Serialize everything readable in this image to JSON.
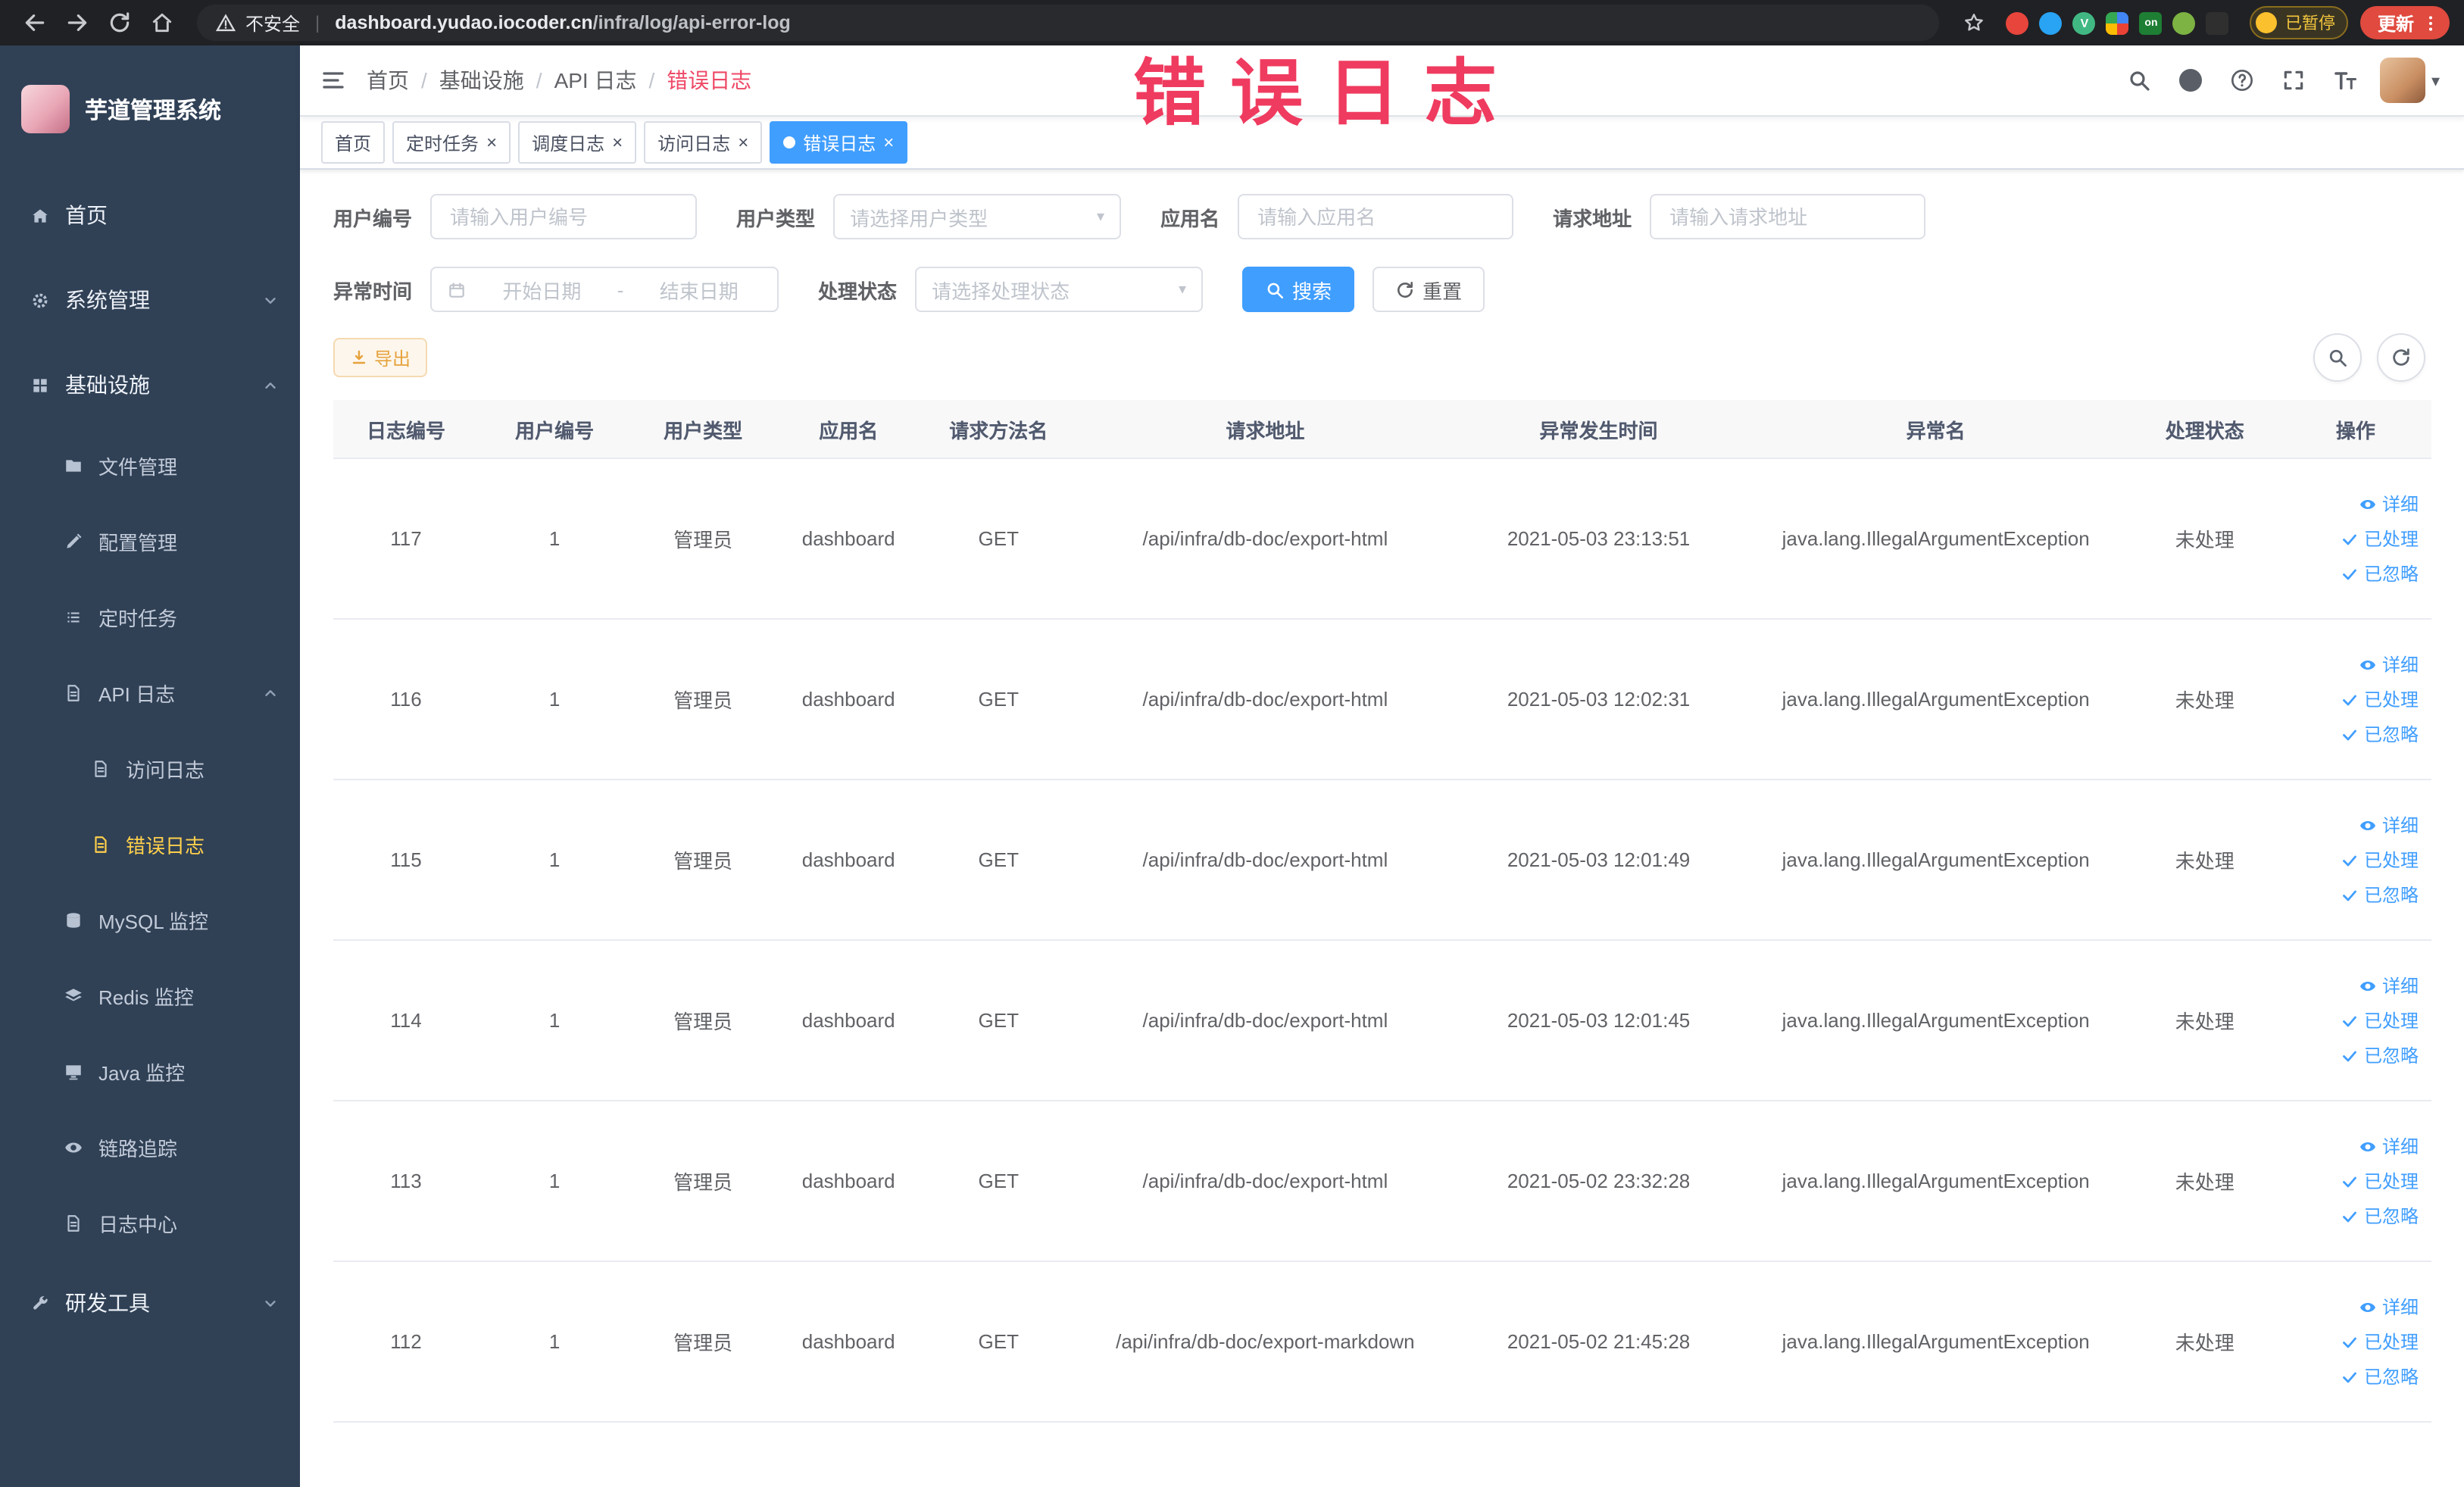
{
  "browser": {
    "security_label": "不安全",
    "url_domain": "dashboard.yudao.iocoder.cn",
    "url_path": "/infra/log/api-error-log",
    "profile_badge": "已暂停",
    "update_label": "更新",
    "extension_on_label": "on",
    "extension_vue_label": "V"
  },
  "annotation": {
    "text": "错误日志"
  },
  "sidebar": {
    "title": "芋道管理系统",
    "items": [
      {
        "key": "home",
        "label": "首页",
        "icon": "home-icon",
        "level": 1
      },
      {
        "key": "system",
        "label": "系统管理",
        "icon": "gear-icon",
        "level": 1,
        "chevron": "down"
      },
      {
        "key": "infra",
        "label": "基础设施",
        "icon": "infra-icon",
        "level": 1,
        "chevron": "up"
      },
      {
        "key": "file",
        "label": "文件管理",
        "icon": "folder-icon",
        "level": 2
      },
      {
        "key": "config",
        "label": "配置管理",
        "icon": "edit-icon",
        "level": 2
      },
      {
        "key": "job",
        "label": "定时任务",
        "icon": "list-icon",
        "level": 2
      },
      {
        "key": "api-log",
        "label": "API 日志",
        "icon": "doc-icon",
        "level": 2,
        "chevron": "up"
      },
      {
        "key": "access-log",
        "label": "访问日志",
        "icon": "doc-icon",
        "level": 3
      },
      {
        "key": "error-log",
        "label": "错误日志",
        "icon": "doc-icon",
        "level": 3,
        "active": true
      },
      {
        "key": "mysql",
        "label": "MySQL 监控",
        "icon": "database-icon",
        "level": 2
      },
      {
        "key": "redis",
        "label": "Redis 监控",
        "icon": "layers-icon",
        "level": 2
      },
      {
        "key": "java",
        "label": "Java 监控",
        "icon": "monitor-icon",
        "level": 2
      },
      {
        "key": "trace",
        "label": "链路追踪",
        "icon": "eye-icon",
        "level": 2
      },
      {
        "key": "log-center",
        "label": "日志中心",
        "icon": "doc-icon",
        "level": 2
      },
      {
        "key": "dev-tools",
        "label": "研发工具",
        "icon": "tool-icon",
        "level": 1,
        "chevron": "down"
      }
    ]
  },
  "navbar": {
    "breadcrumb": [
      "首页",
      "基础设施",
      "API 日志",
      "错误日志"
    ]
  },
  "tabs": [
    {
      "label": "首页",
      "closable": false,
      "active": false
    },
    {
      "label": "定时任务",
      "closable": true,
      "active": false
    },
    {
      "label": "调度日志",
      "closable": true,
      "active": false
    },
    {
      "label": "访问日志",
      "closable": true,
      "active": false
    },
    {
      "label": "错误日志",
      "closable": true,
      "active": true
    }
  ],
  "filters": {
    "user_id": {
      "label": "用户编号",
      "placeholder": "请输入用户编号"
    },
    "user_type": {
      "label": "用户类型",
      "placeholder": "请选择用户类型"
    },
    "app_name": {
      "label": "应用名",
      "placeholder": "请输入应用名"
    },
    "request_url": {
      "label": "请求地址",
      "placeholder": "请输入请求地址"
    },
    "exception_time": {
      "label": "异常时间",
      "start_placeholder": "开始日期",
      "separator": "-",
      "end_placeholder": "结束日期"
    },
    "process_status": {
      "label": "处理状态",
      "placeholder": "请选择处理状态"
    },
    "search_label": "搜索",
    "reset_label": "重置"
  },
  "toolbar": {
    "export_label": "导出"
  },
  "table": {
    "headers": [
      "日志编号",
      "用户编号",
      "用户类型",
      "应用名",
      "请求方法名",
      "请求地址",
      "异常发生时间",
      "异常名",
      "处理状态",
      "操作"
    ],
    "actions": [
      "详细",
      "已处理",
      "已忽略"
    ],
    "rows": [
      {
        "id": "117",
        "user_id": "1",
        "user_type": "管理员",
        "app": "dashboard",
        "method": "GET",
        "url": "/api/infra/db-doc/export-html",
        "time": "2021-05-03 23:13:51",
        "exception": "java.lang.IllegalArgumentException",
        "status": "未处理"
      },
      {
        "id": "116",
        "user_id": "1",
        "user_type": "管理员",
        "app": "dashboard",
        "method": "GET",
        "url": "/api/infra/db-doc/export-html",
        "time": "2021-05-03 12:02:31",
        "exception": "java.lang.IllegalArgumentException",
        "status": "未处理"
      },
      {
        "id": "115",
        "user_id": "1",
        "user_type": "管理员",
        "app": "dashboard",
        "method": "GET",
        "url": "/api/infra/db-doc/export-html",
        "time": "2021-05-03 12:01:49",
        "exception": "java.lang.IllegalArgumentException",
        "status": "未处理"
      },
      {
        "id": "114",
        "user_id": "1",
        "user_type": "管理员",
        "app": "dashboard",
        "method": "GET",
        "url": "/api/infra/db-doc/export-html",
        "time": "2021-05-03 12:01:45",
        "exception": "java.lang.IllegalArgumentException",
        "status": "未处理"
      },
      {
        "id": "113",
        "user_id": "1",
        "user_type": "管理员",
        "app": "dashboard",
        "method": "GET",
        "url": "/api/infra/db-doc/export-html",
        "time": "2021-05-02 23:32:28",
        "exception": "java.lang.IllegalArgumentException",
        "status": "未处理"
      },
      {
        "id": "112",
        "user_id": "1",
        "user_type": "管理员",
        "app": "dashboard",
        "method": "GET",
        "url": "/api/infra/db-doc/export-markdown",
        "time": "2021-05-02 21:45:28",
        "exception": "java.lang.IllegalArgumentException",
        "status": "未处理"
      }
    ]
  },
  "icons": {
    "navbar": [
      "search-icon",
      "github-icon",
      "help-icon",
      "fullscreen-icon",
      "font-size-icon"
    ],
    "table_toolbar": [
      "search-toggle-icon",
      "refresh-icon"
    ],
    "row_actions": [
      "eye-icon",
      "check-icon",
      "check-icon"
    ]
  }
}
